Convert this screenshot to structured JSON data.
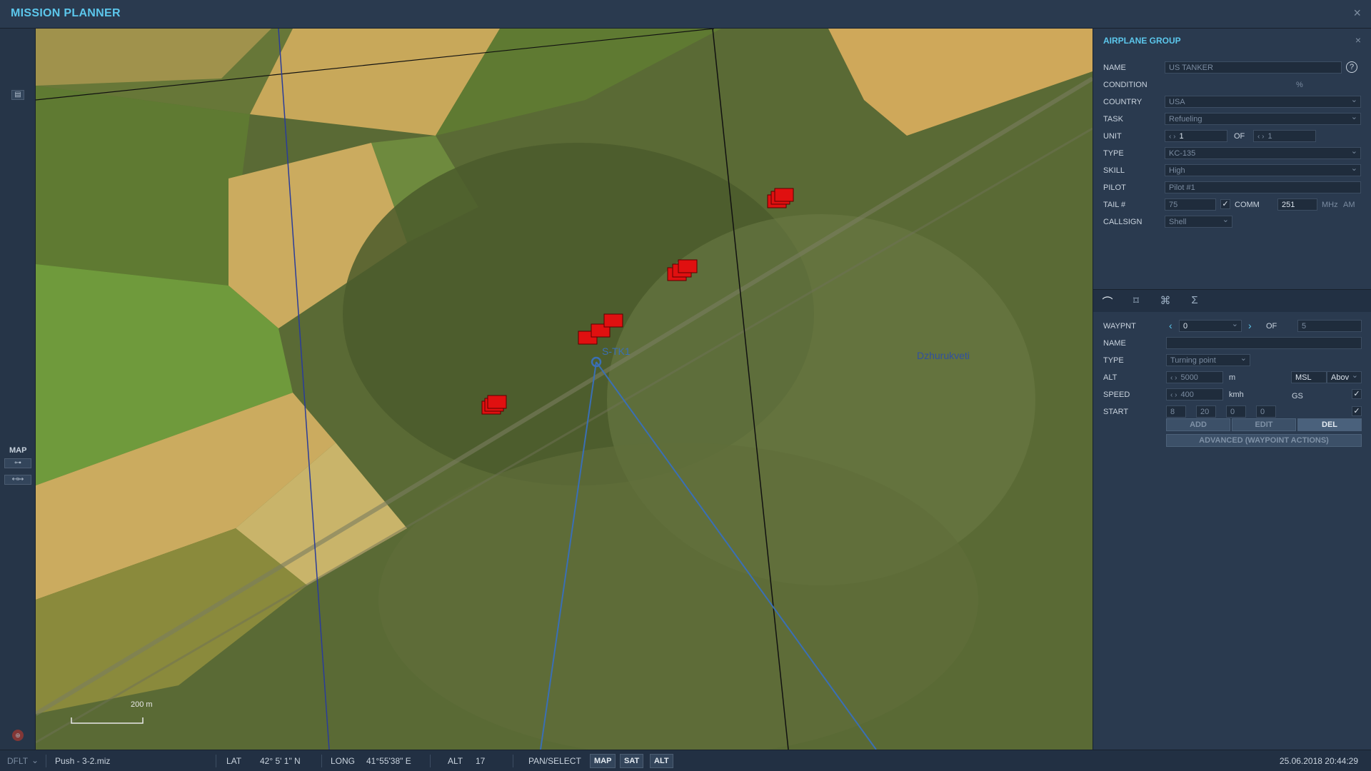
{
  "app": {
    "title": "MISSION PLANNER",
    "close": "×"
  },
  "left_toolbar": {
    "map_label": "MAP"
  },
  "map": {
    "village_label": "Dzhurukveti",
    "waypoint_label": "S-TK1",
    "scale_label": "200 m"
  },
  "panel": {
    "title": "AIRPLANE GROUP",
    "close": "×",
    "name_label": "NAME",
    "name_value": "US TANKER",
    "condition_label": "CONDITION",
    "condition_unit": "%",
    "country_label": "COUNTRY",
    "country_value": "USA",
    "task_label": "TASK",
    "task_value": "Refueling",
    "unit_label": "UNIT",
    "unit_value": "1",
    "unit_of": "OF",
    "unit_total": "1",
    "type_label": "TYPE",
    "type_value": "KC-135",
    "skill_label": "SKILL",
    "skill_value": "High",
    "pilot_label": "PILOT",
    "pilot_value": "Pilot #1",
    "tail_label": "TAIL #",
    "tail_value": "75",
    "comm_label": "COMM",
    "comm_value": "251",
    "comm_unit": "MHz",
    "comm_mod": "AM",
    "callsign_label": "CALLSIGN",
    "callsign_value": "Shell",
    "help": "?"
  },
  "waypoint": {
    "waypnt_label": "WAYPNT",
    "waypnt_value": "0",
    "of_label": "OF",
    "of_value": "5",
    "name_label": "NAME",
    "name_value": "",
    "type_label": "TYPE",
    "type_value": "Turning point",
    "alt_label": "ALT",
    "alt_value": "5000",
    "alt_unit": "m",
    "alt_ref": "MSL",
    "alt_mode": "Abov",
    "speed_label": "SPEED",
    "speed_value": "400",
    "speed_unit": "kmh",
    "speed_gs": "GS",
    "start_label": "START",
    "start_d": "8",
    "start_h": "20",
    "start_m": "0",
    "start_s": "0",
    "add": "ADD",
    "edit": "EDIT",
    "del": "DEL",
    "advanced": "ADVANCED (WAYPOINT ACTIONS)"
  },
  "status": {
    "profile": "DFLT",
    "file": "Push - 3-2.miz",
    "lat_label": "LAT",
    "lat_value": "42° 5' 1\" N",
    "long_label": "LONG",
    "long_value": "41°55'38\" E",
    "alt_label": "ALT",
    "alt_value": "17",
    "mode_label": "PAN/SELECT",
    "map_btn": "MAP",
    "sat_btn": "SAT",
    "alt_btn": "ALT",
    "datetime": "25.06.2018 20:44:29"
  },
  "colors": {
    "accent": "#5cc7ec",
    "route": "#3a6fb5",
    "unit": "#e01010",
    "panel": "#2a3a4f"
  }
}
